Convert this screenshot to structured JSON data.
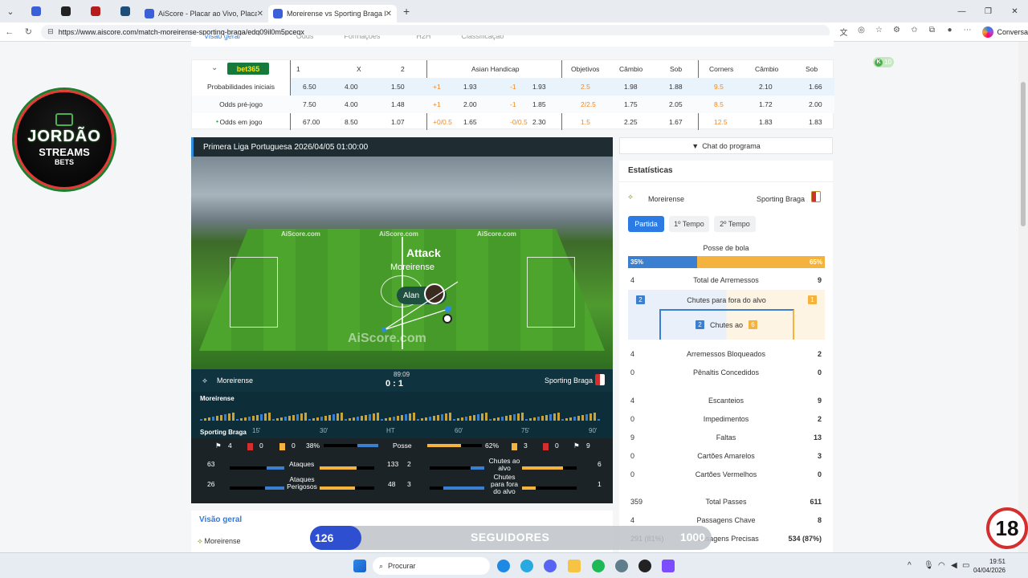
{
  "browser": {
    "tabs": [
      {
        "title": "AiScore - Placar ao Vivo, Placar de"
      },
      {
        "title": "Moreirense vs Sporting Braga live"
      }
    ],
    "url": "https://www.aiscore.com/match-moreirense-sporting-braga/edq09il0m5pceqx",
    "conversa": "Conversa"
  },
  "logo": {
    "l1": "JORDÃO",
    "l2": "STREAMS",
    "l3": "BETS"
  },
  "top_tabs": [
    "Visão geral",
    "Odds",
    "Formações",
    "H2H",
    "Classificação"
  ],
  "odds": {
    "bookmaker": "bet365",
    "headers": [
      "1",
      "X",
      "2",
      "Asian Handicap",
      "Objetivos",
      "Câmbio",
      "Sob",
      "Corners",
      "Câmbio",
      "Sob"
    ],
    "rows": [
      {
        "label": "Probabilidades iniciais",
        "v": [
          "6.50",
          "4.00",
          "1.50",
          "+1",
          "1.93",
          "-1",
          "1.93",
          "2.5",
          "1.98",
          "1.88",
          "9.5",
          "2.10",
          "1.66"
        ]
      },
      {
        "label": "Odds pré-jogo",
        "v": [
          "7.50",
          "4.00",
          "1.48",
          "+1",
          "2.00",
          "-1",
          "1.85",
          "2/2.5",
          "1.75",
          "2.05",
          "8.5",
          "1.72",
          "2.00"
        ]
      },
      {
        "label": "Odds em jogo",
        "v": [
          "67.00",
          "8.50",
          "1.07",
          "+0/0.5",
          "1.65",
          "-0/0.5",
          "2.30",
          "1.5",
          "2.25",
          "1.67",
          "12.5",
          "1.83",
          "1.83"
        ]
      }
    ]
  },
  "k10": "10",
  "match": {
    "title": "Primera Liga Portuguesa 2026/04/05 01:00:00",
    "attack": "Attack",
    "attack_team": "Moreirense",
    "player": "Alan",
    "ad": "AiScore.com",
    "watermark": "AiScore.com",
    "home": "Moreirense",
    "away": "Sporting Braga",
    "time": "89:09",
    "score": "0 : 1",
    "timeline_axis": [
      "15'",
      "30'",
      "HT",
      "60'",
      "75'",
      "90'"
    ]
  },
  "bottom_stats": {
    "row1": {
      "hc": "4",
      "hr": "0",
      "hy": "0",
      "hp": "38%",
      "label": "Posse",
      "ap": "62%",
      "ay": "3",
      "ar": "0",
      "ac": "9",
      "poss_home": 0.38
    },
    "row2": {
      "h": "63",
      "label": "Ataques",
      "a": "133",
      "h2": "2",
      "label2": "Chutes ao alvo",
      "a2": "6"
    },
    "row3": {
      "h": "26",
      "label": "Ataques Perigosos",
      "a": "48",
      "h2": "3",
      "label2": "Chutes para fora do alvo",
      "a2": "1"
    }
  },
  "overview": {
    "title": "Visão geral",
    "home": "Moreirense",
    "away": "Sporting Braga"
  },
  "chat": "Chat do programa",
  "stats": {
    "title": "Estatísticas",
    "home": "Moreirense",
    "away": "Sporting Braga",
    "tabs": [
      "Partida",
      "1º Tempo",
      "2º Tempo"
    ],
    "possession_label": "Posse de bola",
    "possession_home": "35%",
    "possession_away": "65%",
    "possession_home_value": 0.35,
    "shots_total": {
      "h": "4",
      "label": "Total de Arremessos",
      "a": "9"
    },
    "shots_off": {
      "h": "2",
      "label": "Chutes para fora do alvo",
      "a": "1"
    },
    "shots_on": {
      "h": "2",
      "label": "Chutes ao",
      "a": "6"
    },
    "rows": [
      {
        "h": "4",
        "label": "Arremessos Bloqueados",
        "a": "2"
      },
      {
        "h": "0",
        "label": "Pênaltis Concedidos",
        "a": "0"
      },
      {
        "h": "4",
        "label": "Escanteios",
        "a": "9"
      },
      {
        "h": "0",
        "label": "Impedimentos",
        "a": "2"
      },
      {
        "h": "9",
        "label": "Faltas",
        "a": "13"
      },
      {
        "h": "0",
        "label": "Cartões Amarelos",
        "a": "3"
      },
      {
        "h": "0",
        "label": "Cartões Vermelhos",
        "a": "0"
      },
      {
        "h": "359",
        "label": "Total Passes",
        "a": "611"
      },
      {
        "h": "4",
        "label": "Passagens Chave",
        "a": "8"
      },
      {
        "h": "291 (81%)",
        "label": "Passagens Precisas",
        "a": "534 (87%)"
      }
    ]
  },
  "followers": {
    "count": "126",
    "label": "SEGUIDORES",
    "goal": "1000"
  },
  "age": "18",
  "taskbar": {
    "search": "Procurar",
    "time": "19:51",
    "date": "04/04/2026"
  }
}
